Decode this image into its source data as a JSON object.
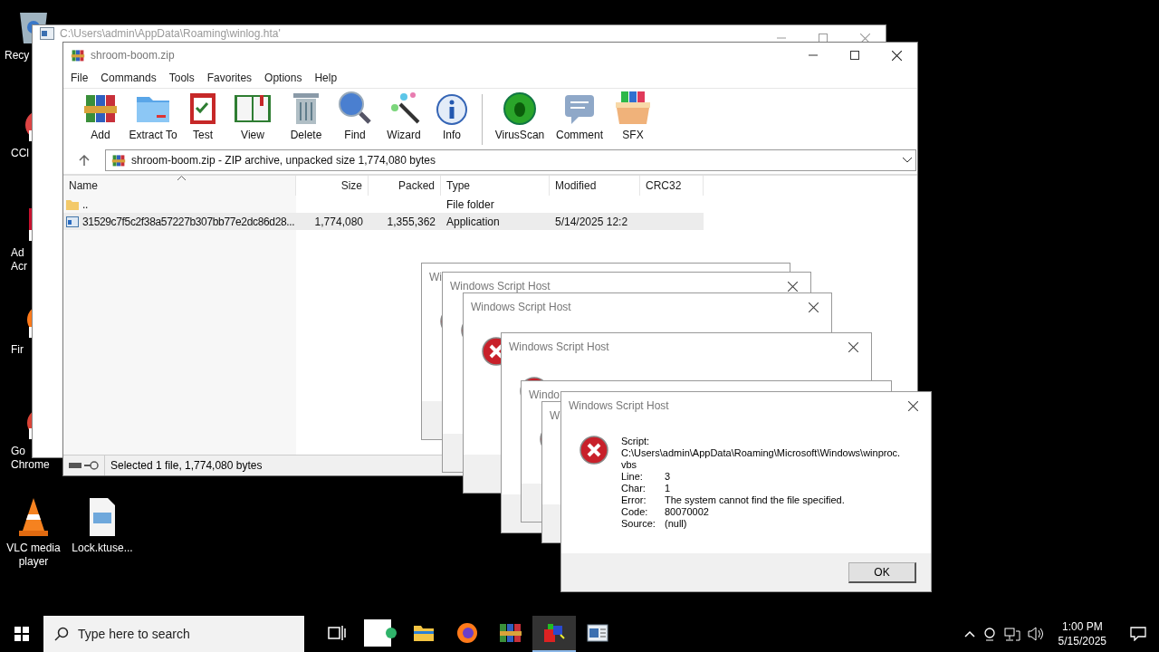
{
  "desktop_icons": [
    {
      "label_lines": [
        "Recy"
      ]
    },
    {
      "label_lines": [
        "CCl"
      ]
    },
    {
      "label_lines": [
        "Ad",
        "Acr"
      ]
    },
    {
      "label_lines": [
        "Fir"
      ]
    },
    {
      "label_lines": [
        "Go",
        "Chrome"
      ]
    },
    {
      "label_lines": [
        "VLC media",
        "player"
      ]
    },
    {
      "label_lines": [
        "Lock.ktuse..."
      ]
    }
  ],
  "back_window": {
    "title": "C:\\Users\\admin\\AppData\\Roaming\\winlog.hta'"
  },
  "archiver": {
    "title": "shroom-boom.zip",
    "menu": [
      "File",
      "Commands",
      "Tools",
      "Favorites",
      "Options",
      "Help"
    ],
    "toolbar_groups": [
      [
        "Add",
        "Extract To",
        "Test",
        "View",
        "Delete",
        "Find",
        "Wizard",
        "Info"
      ],
      [
        "VirusScan",
        "Comment",
        "SFX"
      ]
    ],
    "address": "shroom-boom.zip - ZIP archive, unpacked size 1,774,080 bytes",
    "columns": [
      "Name",
      "Size",
      "Packed",
      "Type",
      "Modified",
      "CRC32"
    ],
    "rows": [
      {
        "kind": "folder",
        "selected": false,
        "cells": [
          "..",
          "",
          "",
          "File folder",
          "",
          ""
        ]
      },
      {
        "kind": "app",
        "selected": true,
        "cells": [
          "31529c7f5c2f38a57227b307bb77e2dc86d28...",
          "1,774,080",
          "1,355,362",
          "Application",
          "5/14/2025 12:2",
          ""
        ]
      }
    ],
    "status": "Selected 1 file, 1,774,080 bytes"
  },
  "dialogs": [
    {
      "title": "Wi",
      "closable": false
    },
    {
      "title": "Windows Script Host",
      "closable": true
    },
    {
      "title": "Windows Script Host",
      "closable": true
    },
    {
      "title": "Windows Script Host",
      "closable": true
    },
    {
      "title": "Windo",
      "closable": false
    },
    {
      "title": "W",
      "closable": false
    },
    {
      "title": "Windows Script Host",
      "closable": true,
      "script_label": "Script:",
      "script_path": "C:\\Users\\admin\\AppData\\Roaming\\Microsoft\\Windows\\winproc.vbs",
      "fields": [
        {
          "label": "Line:",
          "value": "3"
        },
        {
          "label": "Char:",
          "value": "1"
        },
        {
          "label": "Error:",
          "value": "The system cannot find the file specified."
        },
        {
          "label": "Code:",
          "value": "80070002"
        },
        {
          "label": "Source:",
          "value": "(null)"
        }
      ],
      "button": "OK"
    }
  ],
  "taskbar": {
    "search": {
      "placeholder": "Type here to search"
    },
    "apps": [
      {
        "selected": false
      },
      {
        "selected": false
      },
      {
        "selected": false
      },
      {
        "selected": false
      },
      {
        "selected": false
      },
      {
        "selected": true
      },
      {
        "selected": false
      }
    ],
    "time": "1:00 PM",
    "date": "5/15/2025"
  }
}
